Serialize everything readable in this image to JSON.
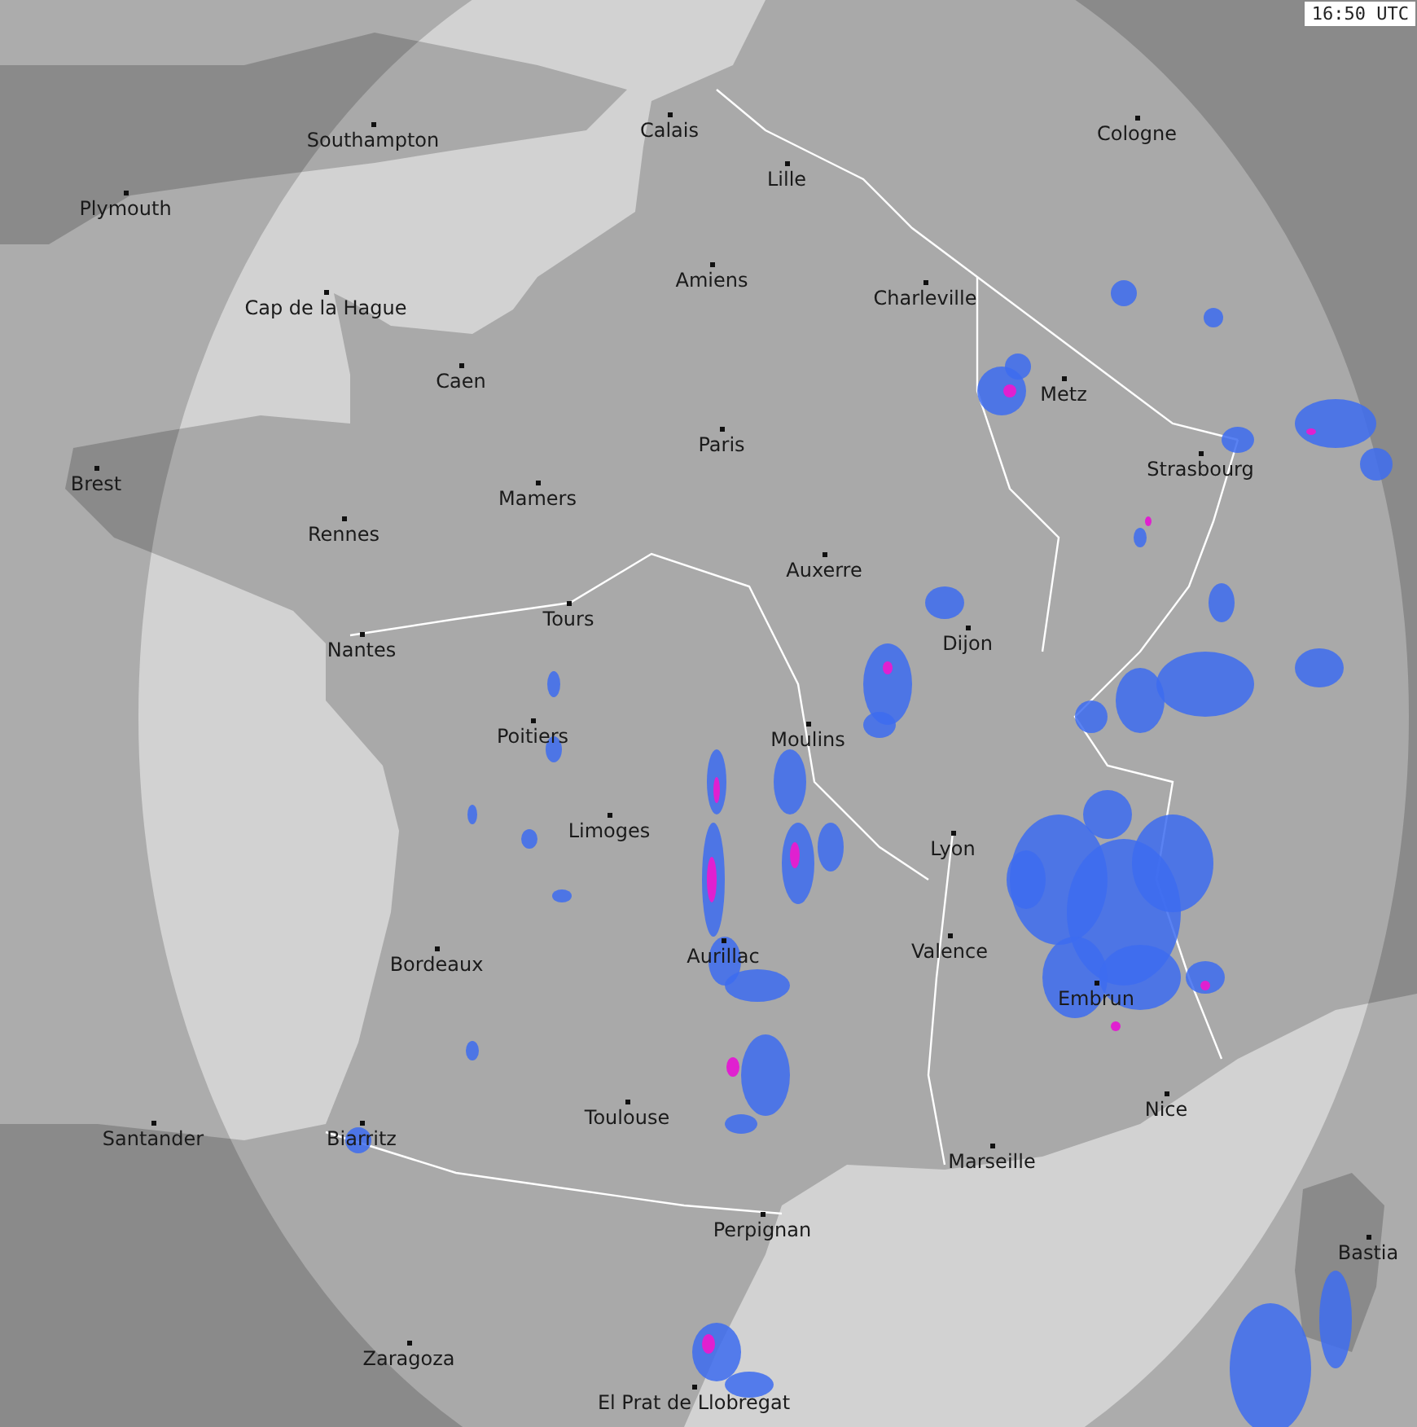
{
  "timestamp": "16:50 UTC",
  "cities": [
    {
      "name": "Southampton"
    },
    {
      "name": "Calais"
    },
    {
      "name": "Plymouth"
    },
    {
      "name": "Lille"
    },
    {
      "name": "Cologne"
    },
    {
      "name": "Amiens"
    },
    {
      "name": "Charleville"
    },
    {
      "name": "Cap de la Hague"
    },
    {
      "name": "Caen"
    },
    {
      "name": "Metz"
    },
    {
      "name": "Paris"
    },
    {
      "name": "Brest"
    },
    {
      "name": "Strasbourg"
    },
    {
      "name": "Mamers"
    },
    {
      "name": "Rennes"
    },
    {
      "name": "Auxerre"
    },
    {
      "name": "Tours"
    },
    {
      "name": "Nantes"
    },
    {
      "name": "Dijon"
    },
    {
      "name": "Poitiers"
    },
    {
      "name": "Moulins"
    },
    {
      "name": "Limoges"
    },
    {
      "name": "Lyon"
    },
    {
      "name": "Aurillac"
    },
    {
      "name": "Valence"
    },
    {
      "name": "Bordeaux"
    },
    {
      "name": "Embrun"
    },
    {
      "name": "Nice"
    },
    {
      "name": "Santander"
    },
    {
      "name": "Biarritz"
    },
    {
      "name": "Toulouse"
    },
    {
      "name": "Marseille"
    },
    {
      "name": "Perpignan"
    },
    {
      "name": "Bastia"
    },
    {
      "name": "Zaragoza"
    },
    {
      "name": "El Prat de Llobregat"
    }
  ]
}
